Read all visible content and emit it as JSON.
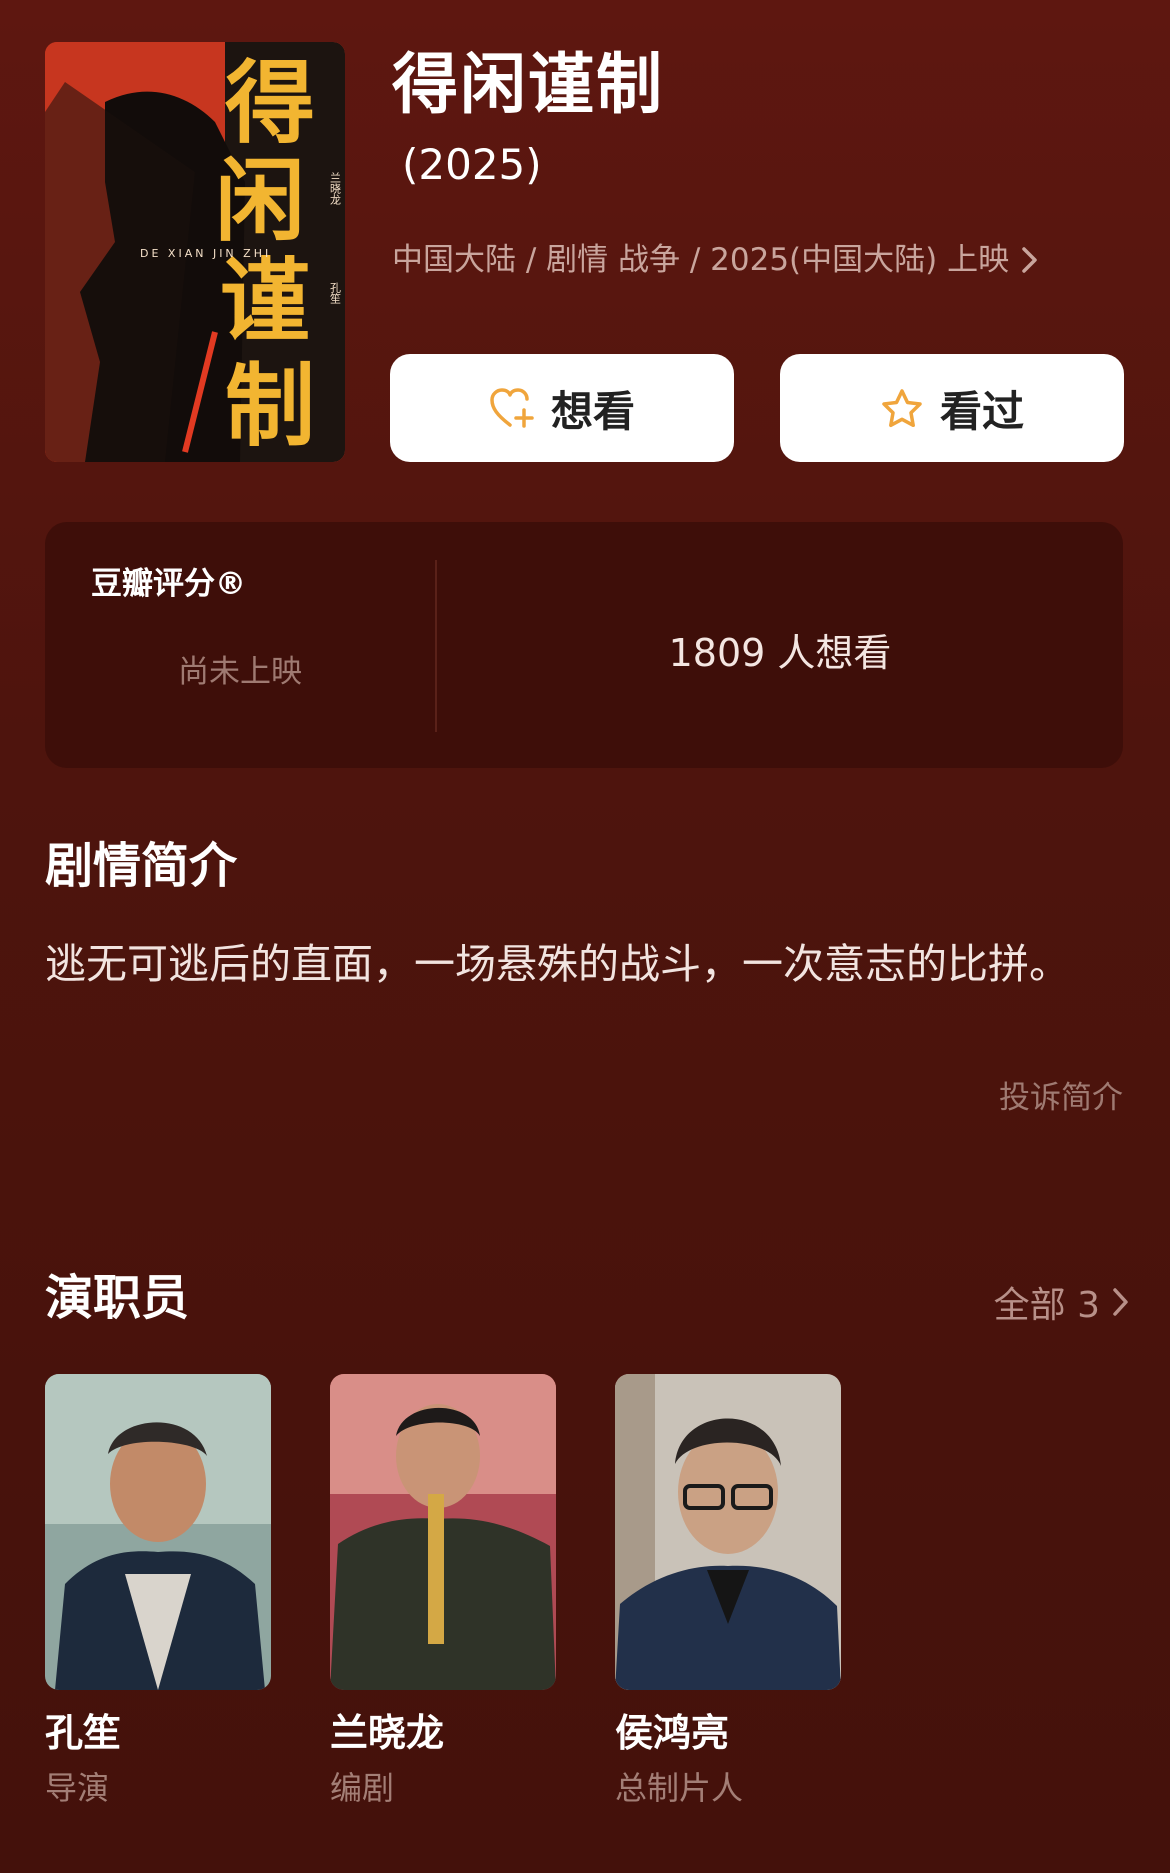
{
  "movie": {
    "title": "得闲谨制",
    "year": "(2025)",
    "meta": "中国大陆 / 剧情 战争 / 2025(中国大陆) 上映",
    "poster": {
      "title_chars": [
        "得",
        "闲",
        "谨",
        "制"
      ],
      "pinyin": "DE XIAN JIN ZHI",
      "credit_1": "兰晓龙",
      "credit_2": "孔笙"
    }
  },
  "actions": {
    "want_label": "想看",
    "seen_label": "看过"
  },
  "rating": {
    "label": "豆瓣评分®",
    "status": "尚未上映",
    "want_count": "1809 人想看"
  },
  "synopsis": {
    "title": "剧情简介",
    "text": "逃无可逃后的直面，一场悬殊的战斗，一次意志的比拼。",
    "report_label": "投诉简介"
  },
  "cast": {
    "title": "演职员",
    "all_label": "全部 3",
    "members": [
      {
        "name": "孔笙",
        "role": "导演"
      },
      {
        "name": "兰晓龙",
        "role": "编剧"
      },
      {
        "name": "侯鸿亮",
        "role": "总制片人"
      }
    ]
  },
  "colors": {
    "background": "#5e1710",
    "card": "#3e0e09",
    "accent": "#f0a53c",
    "poster_red": "#c7361f",
    "poster_yellow": "#f2b531"
  },
  "icons": [
    "heart-plus-icon",
    "star-icon",
    "chevron-right-icon"
  ]
}
